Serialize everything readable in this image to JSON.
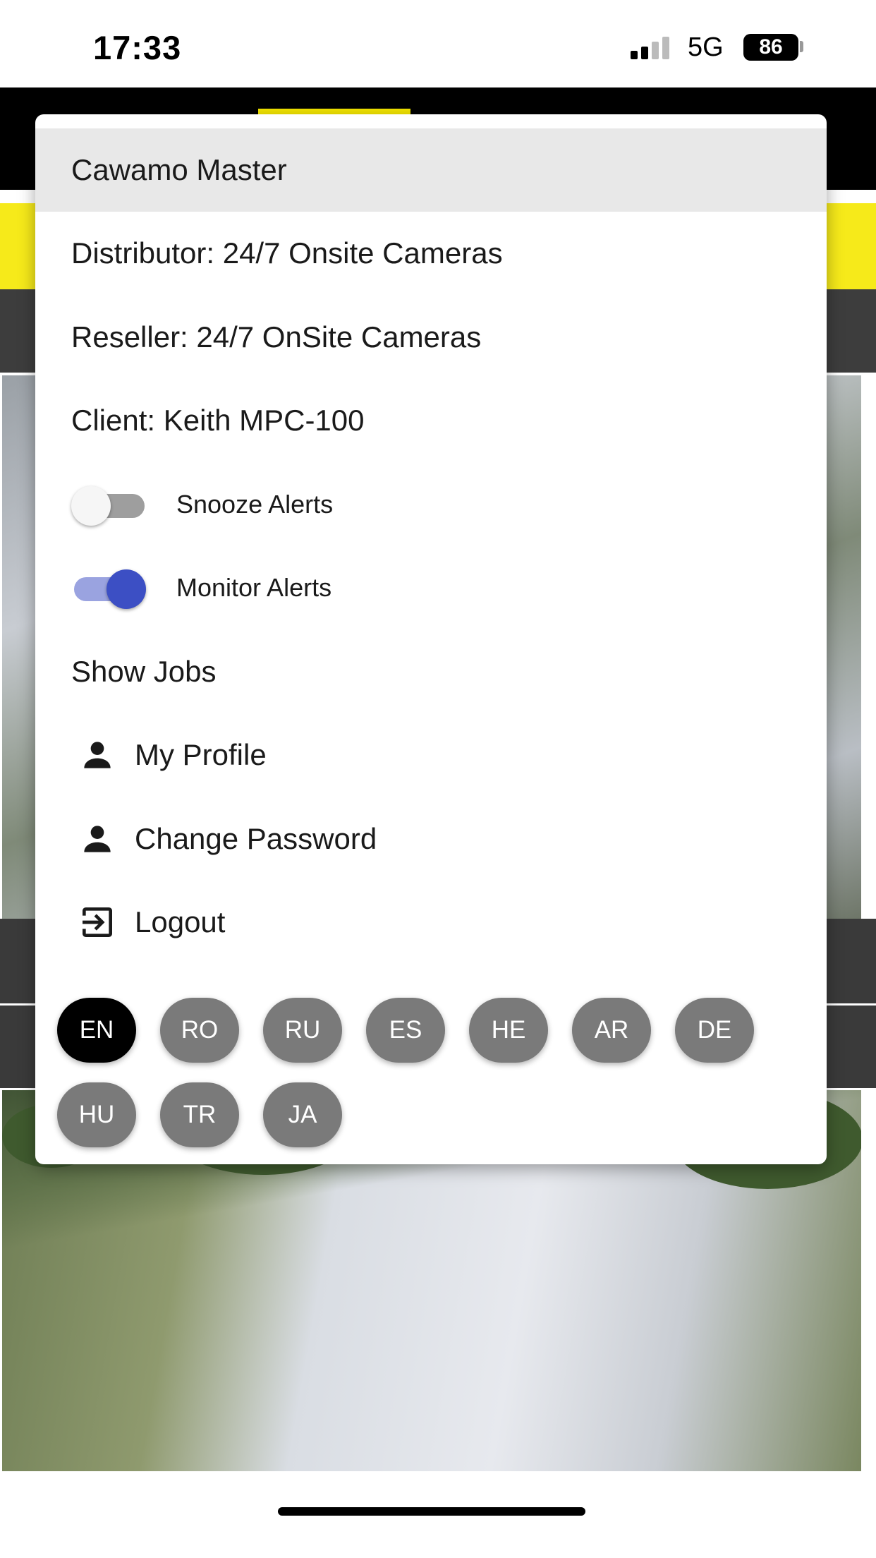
{
  "status_bar": {
    "time": "17:33",
    "network": "5G",
    "battery": "86"
  },
  "menu": {
    "account": "Cawamo Master",
    "distributor": "Distributor: 24/7 Onsite Cameras",
    "reseller": "Reseller: 24/7 OnSite Cameras",
    "client": "Client: Keith MPC-100",
    "snooze_alerts": {
      "label": "Snooze Alerts",
      "on": false
    },
    "monitor_alerts": {
      "label": "Monitor Alerts",
      "on": true
    },
    "show_jobs": "Show Jobs",
    "my_profile": {
      "label": "My Profile",
      "icon": "person-icon"
    },
    "change_password": {
      "label": "Change Password",
      "icon": "person-icon"
    },
    "logout": {
      "label": "Logout",
      "icon": "logout-icon"
    }
  },
  "languages": {
    "selected": "EN",
    "items": [
      "EN",
      "RO",
      "RU",
      "ES",
      "HE",
      "AR",
      "DE",
      "HU",
      "TR",
      "JA"
    ]
  },
  "colors": {
    "toggle_on": "#3c4fc4",
    "toggle_off": "#9e9e9e",
    "language_active": "#000000",
    "language_inactive": "#7a7a7a",
    "brand_yellow": "#f6ea1a"
  }
}
